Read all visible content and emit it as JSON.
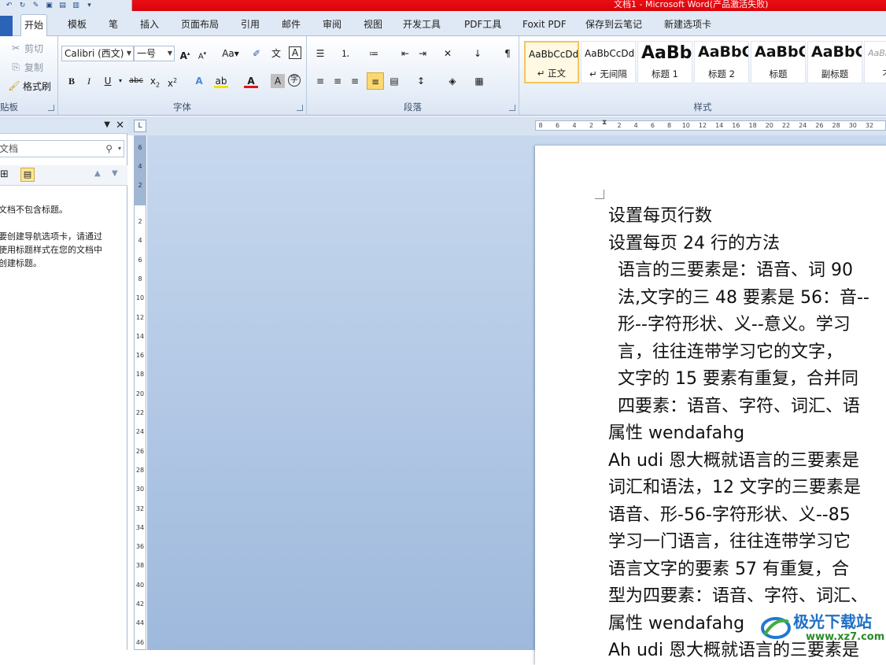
{
  "window": {
    "title": "文档1 - Microsoft Word(产品激活失败)"
  },
  "tabs": [
    "开始",
    "模板",
    "笔",
    "插入",
    "页面布局",
    "引用",
    "邮件",
    "审阅",
    "视图",
    "开发工具",
    "PDF工具",
    "Foxit PDF",
    "保存到云笔记",
    "新建选项卡"
  ],
  "active_tab": "开始",
  "clipboard": {
    "cut": "剪切",
    "copy": "复制",
    "format_painter": "格式刷",
    "label": "贴板"
  },
  "font": {
    "name": "Calibri (西文)",
    "size": "一号",
    "case_button": "Aa",
    "label": "字体"
  },
  "paragraph": {
    "label": "段落"
  },
  "styles": {
    "label": "样式",
    "items": [
      {
        "sample": "AaBbCcDd",
        "name": "↵ 正文"
      },
      {
        "sample": "AaBbCcDd",
        "name": "↵ 无间隔"
      },
      {
        "sample": "AaBb",
        "name": "标题 1"
      },
      {
        "sample": "AaBbC",
        "name": "标题 2"
      },
      {
        "sample": "AaBbC",
        "name": "标题"
      },
      {
        "sample": "AaBbC",
        "name": "副标题"
      },
      {
        "sample": "AaBbC",
        "name": "不明"
      }
    ]
  },
  "ruler": {
    "h_numbers": [
      "8",
      "6",
      "4",
      "2",
      "2",
      "4",
      "6",
      "8",
      "10",
      "12",
      "14",
      "16",
      "18",
      "20",
      "22",
      "24",
      "26",
      "28",
      "30",
      "32"
    ],
    "v_numbers": [
      "6",
      "4",
      "2",
      "2",
      "4",
      "6",
      "8",
      "10",
      "12",
      "14",
      "16",
      "18",
      "20",
      "22",
      "24",
      "26",
      "28",
      "30",
      "32",
      "34",
      "36",
      "38",
      "40",
      "42",
      "44",
      "46"
    ]
  },
  "nav_pane": {
    "search_placeholder": "文档",
    "message1": "文档不包含标题。",
    "message2_lines": [
      "要创建导航选项卡，请通过",
      "使用标题样式在您的文档中",
      "创建标题。"
    ]
  },
  "document": {
    "lines": [
      {
        "text": "设置每页行数",
        "indent": false
      },
      {
        "text": "设置每页 24 行的方法",
        "indent": false
      },
      {
        "text": "语言的三要素是：语音、词 90",
        "indent": true
      },
      {
        "text": "法,文字的三 48 要素是 56：音--",
        "indent": true
      },
      {
        "text": "形--字符形状、义--意义。学习",
        "indent": true
      },
      {
        "text": "言，往往连带学习它的文字，",
        "indent": true
      },
      {
        "text": "文字的 15 要素有重复，合并同",
        "indent": true
      },
      {
        "text": "四要素：语音、字符、词汇、语",
        "indent": true
      },
      {
        "text": "属性 wendafahg",
        "indent": false
      },
      {
        "text": "Ah udi 恩大概就语言的三要素是",
        "indent": false
      },
      {
        "text": "词汇和语法，12 文字的三要素是",
        "indent": false
      },
      {
        "text": "语音、形-56-字符形状、义--85",
        "indent": false
      },
      {
        "text": "学习一门语言，往往连带学习它",
        "indent": false
      },
      {
        "text": "语言文字的要素 57 有重复，合",
        "indent": false
      },
      {
        "text": "型为四要素：语音、字符、词汇、",
        "indent": false
      },
      {
        "text": "属性 wendafahg",
        "indent": false
      },
      {
        "text": "Ah udi 恩大概就语言的三要素是",
        "indent": false
      }
    ]
  },
  "watermark": {
    "name": "极光下载站",
    "url": "www.xz7.com"
  },
  "colors": {
    "title_bar": "#e30a12",
    "ribbon_bg": "#e7eef8",
    "workspace": "#b3c9e6",
    "highlight": "#f2c660"
  }
}
